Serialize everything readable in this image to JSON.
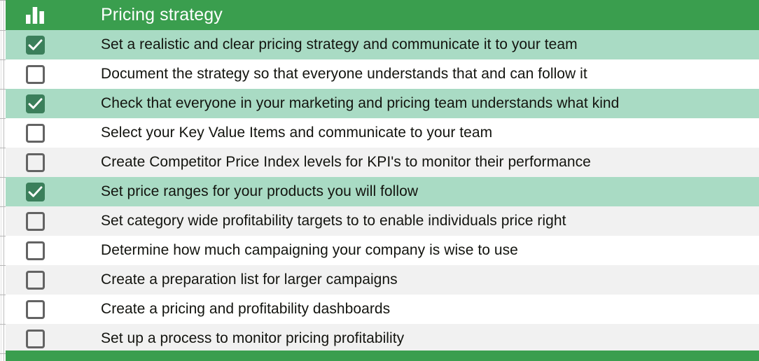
{
  "header": {
    "icon": "bar-chart-icon",
    "title": "Pricing strategy",
    "background_color": "#3a9e4e",
    "text_color": "#ffffff"
  },
  "colors": {
    "header_green": "#3a9e4e",
    "row_done_green": "#a9dbc4",
    "row_alt_gray": "#f1f1f1",
    "row_white": "#ffffff",
    "checkbox_checked": "#3b7f5b",
    "checkbox_unchecked_border": "#636363",
    "text": "#13140f",
    "grid_line": "#bdbdbd"
  },
  "rows": [
    {
      "checked": true,
      "label": "Set a realistic and clear pricing strategy and communicate it to your team"
    },
    {
      "checked": false,
      "label": "Document the strategy so that everyone understands that and can follow it"
    },
    {
      "checked": true,
      "label": "Check that everyone in your marketing and pricing team understands what kind"
    },
    {
      "checked": false,
      "label": "Select your Key Value Items and communicate to your team"
    },
    {
      "checked": false,
      "label": "Create Competitor Price Index levels for KPI's to monitor their performance"
    },
    {
      "checked": true,
      "label": "Set price ranges for your products you will follow"
    },
    {
      "checked": false,
      "label": "Set category wide profitability targets to to enable individuals price right"
    },
    {
      "checked": false,
      "label": "Determine how much campaigning your company is wise to use"
    },
    {
      "checked": false,
      "label": "Create a preparation list for larger campaigns"
    },
    {
      "checked": false,
      "label": "Create a pricing and profitability dashboards"
    },
    {
      "checked": false,
      "label": "Set up a process to monitor pricing profitability"
    }
  ]
}
